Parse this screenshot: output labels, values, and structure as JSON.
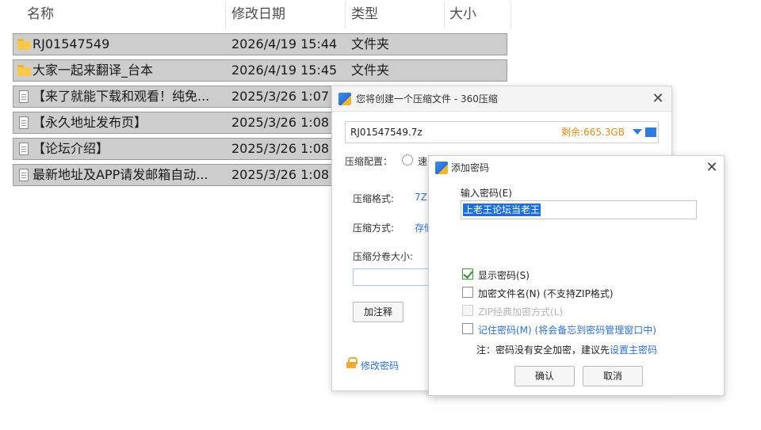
{
  "explorer": {
    "columns": {
      "name": "名称",
      "date": "修改日期",
      "type": "类型",
      "size": "大小"
    },
    "rows": [
      {
        "icon": "folder-icon",
        "name": "RJ01547549",
        "date": "2026/4/19 15:44",
        "type": "文件夹"
      },
      {
        "icon": "folder-icon",
        "name": "大家一起来翻译_台本",
        "date": "2026/4/19 15:45",
        "type": "文件夹"
      },
      {
        "icon": "file-icon",
        "name": "【来了就能下载和观看！纯免...",
        "date": "2025/3/26 1:07",
        "type": ""
      },
      {
        "icon": "file-icon",
        "name": "【永久地址发布页】",
        "date": "2025/3/26 1:08",
        "type": ""
      },
      {
        "icon": "file-icon",
        "name": "【论坛介绍】",
        "date": "2025/3/26 1:08",
        "type": ""
      },
      {
        "icon": "file-icon",
        "name": "最新地址及APP请发邮箱自动...",
        "date": "2025/3/26 1:08",
        "type": ""
      }
    ]
  },
  "compress_dialog": {
    "title": "您将创建一个压缩文件 - 360压缩",
    "filename": "RJ01547549.7z",
    "free_space": "剩余:665.3GB",
    "config_label": "压缩配置：",
    "config_option": "速",
    "format_label": "压缩格式:",
    "format_value": "7Z",
    "method_label": "压缩方式:",
    "method_value": "存储",
    "split_label": "压缩分卷大小:",
    "comment_button": "加注释",
    "change_password": "修改密码"
  },
  "password_dialog": {
    "title": "添加密码",
    "input_label": "输入密码(E)",
    "password_value": "上老王论坛当老王",
    "options": {
      "show_password": "显示密码(S)",
      "encrypt_filenames": "加密文件名(N) (不支持ZIP格式)",
      "zip_classic": "ZIP经典加密方式(L)",
      "remember_password": "记住密码(M) (将会备忘到密码管理窗口中)"
    },
    "note_prefix": "注：密码没有安全加密，建议先",
    "note_link": "设置主密码",
    "ok_button": "确认",
    "cancel_button": "取消"
  },
  "colors": {
    "row_selected_bg": "#cdcdcd",
    "accent_blue": "#2e6fd6",
    "free_space_orange": "#e58b19",
    "selection_blue": "#1e6fd9"
  }
}
